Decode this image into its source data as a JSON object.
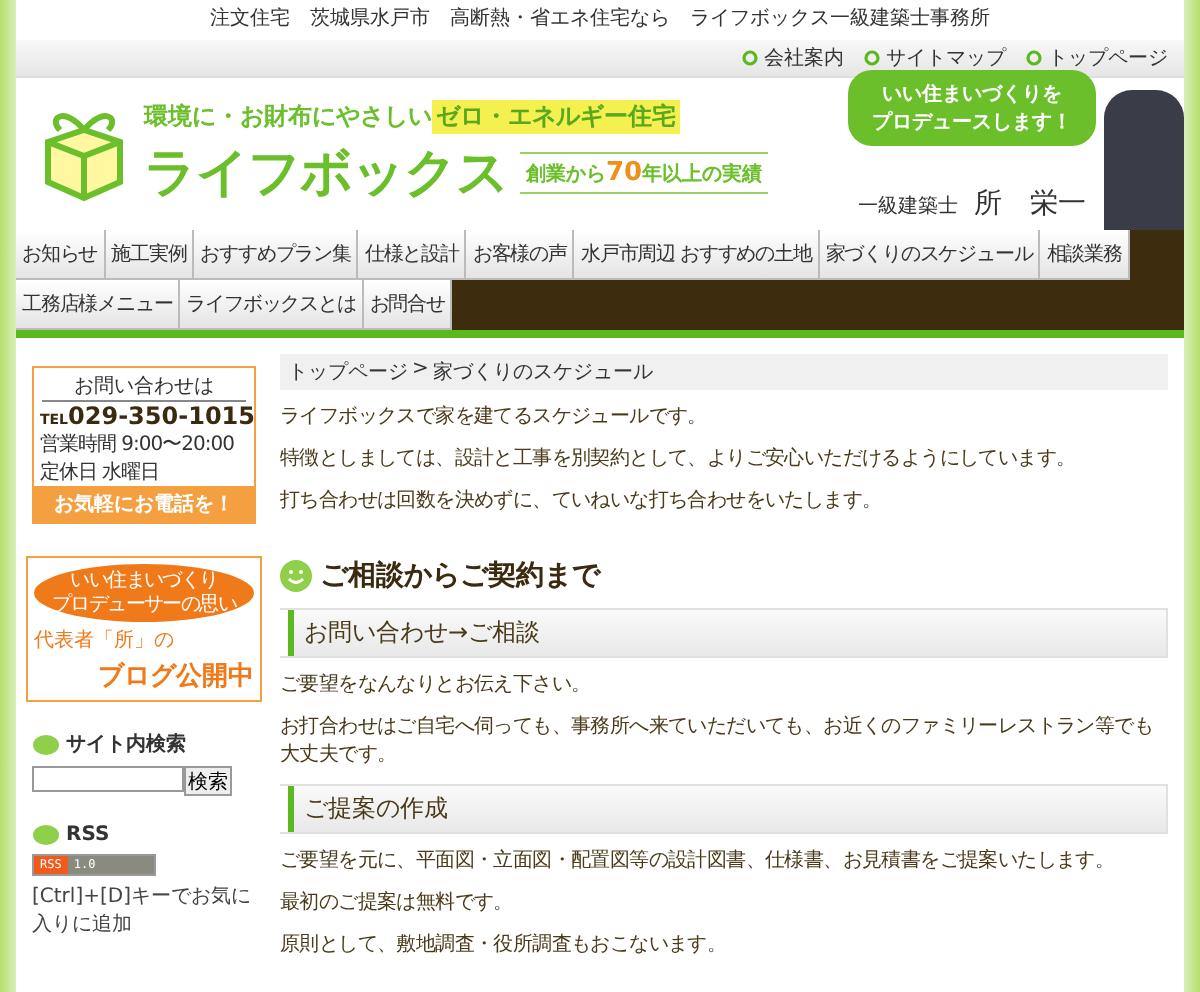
{
  "tagline": "注文住宅　茨城県水戸市　高断熱・省エネ住宅なら　ライフボックス一級建築士事務所",
  "util_links": [
    "会社案内",
    "サイトマップ",
    "トップページ"
  ],
  "header": {
    "catch_lead": "環境に・お財布にやさしい",
    "catch_highlight": "ゼロ・エネルギー住宅",
    "logo_text": "ライフボックス",
    "since": "創業から**70**年以上の実績",
    "bubble_lines": [
      "いい住まいづくりを",
      "プロデュースします！"
    ],
    "role": "一級建築士",
    "name": "所　栄一"
  },
  "nav_rows": [
    [
      "お知らせ",
      "施工実例",
      "おすすめプラン集",
      "仕様と設計",
      "お客様の声",
      "水戸市周辺 おすすめの土地",
      "家づくりのスケジュール",
      "相談業務"
    ],
    [
      "工務店様メニュー",
      "ライフボックスとは",
      "お問合せ"
    ]
  ],
  "sidebar": {
    "contact": {
      "heading": "お問い合わせは",
      "tel_prefix": "TEL",
      "tel": "029-350-1015",
      "hours": "営業時間 9:00〜20:00",
      "holiday": "定休日 水曜日",
      "cta": "お気軽にお電話を！"
    },
    "blog": {
      "bubble_lines": [
        "いい住まいづくり",
        "プロデューサーの思い"
      ],
      "line1": "代表者「所」の",
      "line2": "ブログ公開中"
    },
    "search_heading": "サイト内検索",
    "search_button": "検索",
    "rss_heading": "RSS",
    "rss_badge": [
      "RSS",
      "1.0"
    ],
    "bookmark": "[Ctrl]+[D]キーでお気に入りに追加"
  },
  "main": {
    "breadcrumb": [
      "トップページ",
      "家づくりのスケジュール"
    ],
    "breadcrumb_sep": ">",
    "intro": [
      "ライフボックスで家を建てるスケジュールです。",
      "特徴としましては、設計と工事を別契約として、よりご安心いただけるようにしています。",
      "打ち合わせは回数を決めずに、ていねいな打ち合わせをいたします。"
    ],
    "section_title": "ご相談からご契約まで",
    "steps": [
      {
        "title": "お問い合わせ→ご相談",
        "paragraphs": [
          "ご要望をなんなりとお伝え下さい。",
          "お打合わせはご自宅へ伺っても、事務所へ来ていただいても、お近くのファミリーレストラン等でも大丈夫です。"
        ]
      },
      {
        "title": "ご提案の作成",
        "paragraphs": [
          "ご要望を元に、平面図・立面図・配置図等の設計図書、仕様書、お見積書をご提案いたします。",
          "最初のご提案は無料です。",
          "原則として、敷地調査・役所調査もおこないます。"
        ]
      }
    ]
  }
}
